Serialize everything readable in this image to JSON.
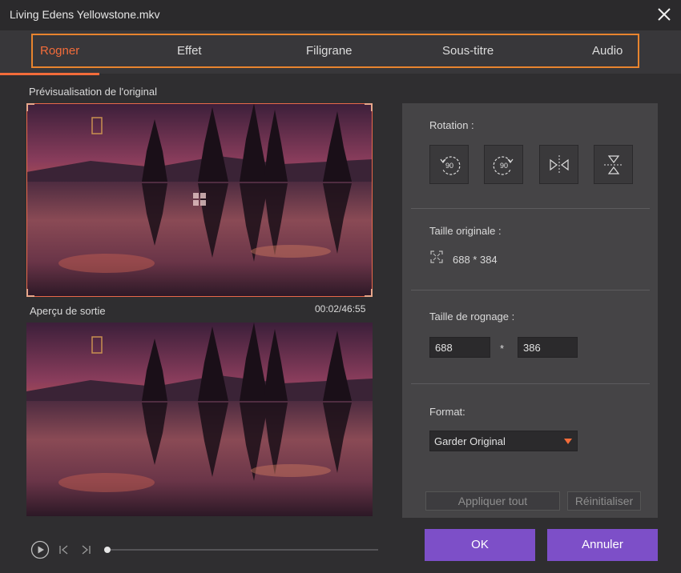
{
  "window": {
    "title": "Living Edens Yellowstone.mkv"
  },
  "tabs": [
    {
      "label": "Rogner",
      "active": true
    },
    {
      "label": "Effet",
      "active": false
    },
    {
      "label": "Filigrane",
      "active": false
    },
    {
      "label": "Sous-titre",
      "active": false
    },
    {
      "label": "Audio",
      "active": false
    }
  ],
  "preview": {
    "original_label": "Prévisualisation de l'original",
    "output_label": "Aperçu de sortie",
    "timecode": "00:02/46:55"
  },
  "settings": {
    "rotation_label": "Rotation :",
    "rotation_buttons": [
      {
        "icon": "rotate-left-90-icon",
        "text": "90"
      },
      {
        "icon": "rotate-right-90-icon",
        "text": "90"
      },
      {
        "icon": "flip-horizontal-icon"
      },
      {
        "icon": "flip-vertical-icon"
      }
    ],
    "original_size_label": "Taille originale :",
    "original_size_value": "688 * 384",
    "crop_size_label": "Taille de rognage :",
    "crop_width": "688",
    "crop_times": "*",
    "crop_height": "386",
    "format_label": "Format:",
    "format_value": "Garder Original",
    "apply_all": "Appliquer tout",
    "reset": "Réinitialiser"
  },
  "buttons": {
    "ok": "OK",
    "cancel": "Annuler"
  },
  "colors": {
    "accent": "#f36c3a",
    "tab_outline": "#e8842e",
    "primary_button": "#7d4fc8"
  }
}
